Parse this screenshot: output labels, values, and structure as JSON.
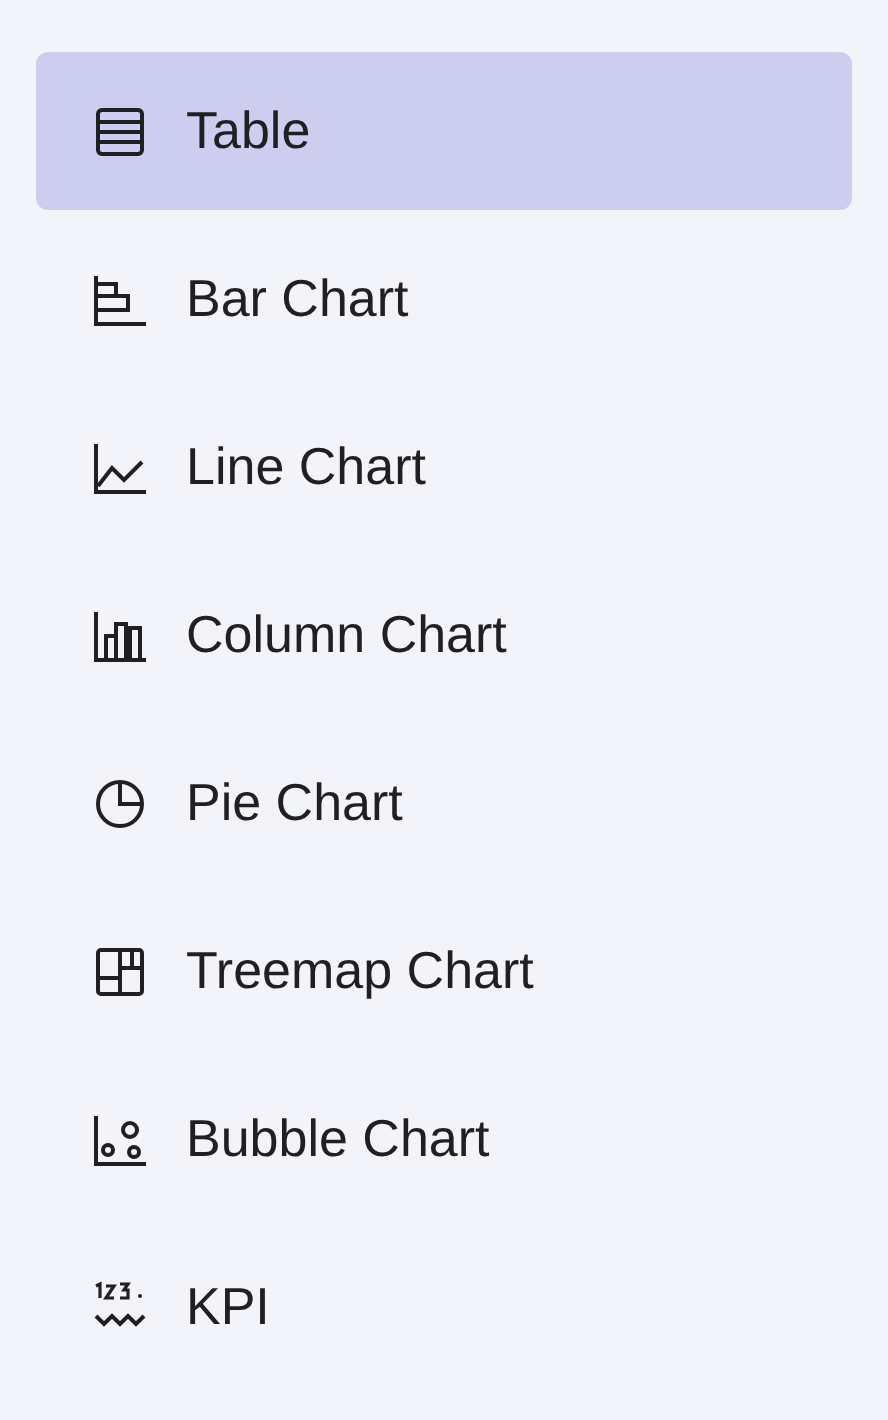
{
  "menu": [
    {
      "label": "Table",
      "kind": "table",
      "selected": true
    },
    {
      "label": "Bar Chart",
      "kind": "bar",
      "selected": false
    },
    {
      "label": "Line Chart",
      "kind": "line",
      "selected": false
    },
    {
      "label": "Column Chart",
      "kind": "column",
      "selected": false
    },
    {
      "label": "Pie Chart",
      "kind": "pie",
      "selected": false
    },
    {
      "label": "Treemap Chart",
      "kind": "treemap",
      "selected": false
    },
    {
      "label": "Bubble Chart",
      "kind": "bubble",
      "selected": false
    },
    {
      "label": "KPI",
      "kind": "kpi",
      "selected": false
    }
  ]
}
